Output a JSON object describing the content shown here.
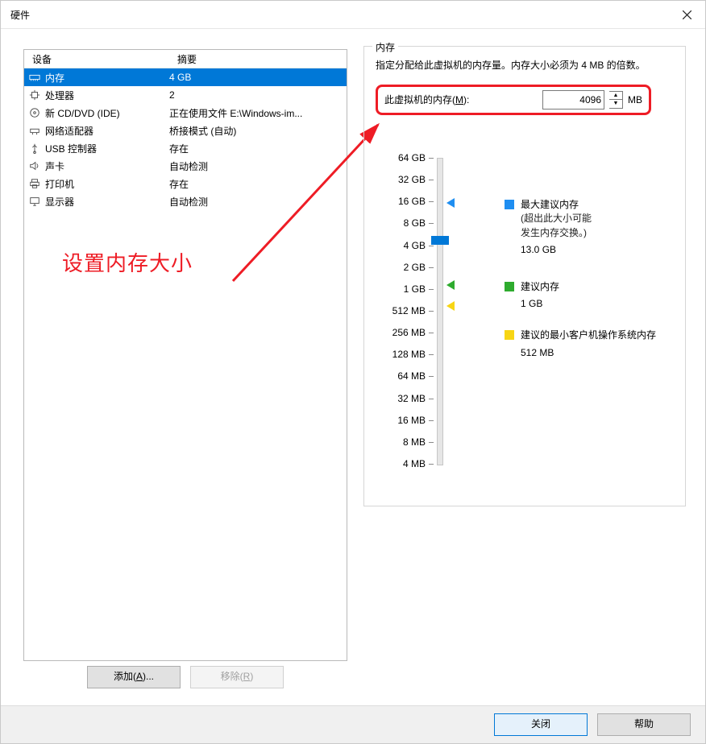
{
  "title": "硬件",
  "left": {
    "headers": {
      "device": "设备",
      "summary": "摘要"
    },
    "rows": [
      {
        "icon": "memory-icon",
        "device": "内存",
        "summary": "4 GB",
        "selected": true
      },
      {
        "icon": "cpu-icon",
        "device": "处理器",
        "summary": "2"
      },
      {
        "icon": "disc-icon",
        "device": "新 CD/DVD (IDE)",
        "summary": "正在使用文件 E:\\Windows-im..."
      },
      {
        "icon": "network-icon",
        "device": "网络适配器",
        "summary": "桥接模式 (自动)"
      },
      {
        "icon": "usb-icon",
        "device": "USB 控制器",
        "summary": "存在"
      },
      {
        "icon": "sound-icon",
        "device": "声卡",
        "summary": "自动检测"
      },
      {
        "icon": "printer-icon",
        "device": "打印机",
        "summary": "存在"
      },
      {
        "icon": "display-icon",
        "device": "显示器",
        "summary": "自动检测"
      }
    ],
    "add_button": "添加(",
    "add_key": "A",
    "add_suffix": ")...",
    "remove_button": "移除(",
    "remove_key": "R",
    "remove_suffix": ")"
  },
  "annotation": "设置内存大小",
  "memory": {
    "group_title": "内存",
    "desc": "指定分配给此虚拟机的内存量。内存大小必须为 4 MB 的倍数。",
    "label_pre": "此虚拟机的内存(",
    "label_key": "M",
    "label_post": "):",
    "value": "4096",
    "unit": "MB",
    "ticks": [
      "64 GB",
      "32 GB",
      "16 GB",
      "8 GB",
      "4 GB",
      "2 GB",
      "1 GB",
      "512 MB",
      "256 MB",
      "128 MB",
      "64 MB",
      "32 MB",
      "16 MB",
      "8 MB",
      "4 MB"
    ],
    "legend": {
      "max": {
        "title": "最大建议内存",
        "note1": "(超出此大小可能",
        "note2": "发生内存交换。)",
        "value": "13.0 GB"
      },
      "rec": {
        "title": "建议内存",
        "value": "1 GB"
      },
      "min": {
        "title": "建议的最小客户机操作系统内存",
        "value": "512 MB"
      }
    }
  },
  "footer": {
    "close": "关闭",
    "help": "帮助"
  }
}
